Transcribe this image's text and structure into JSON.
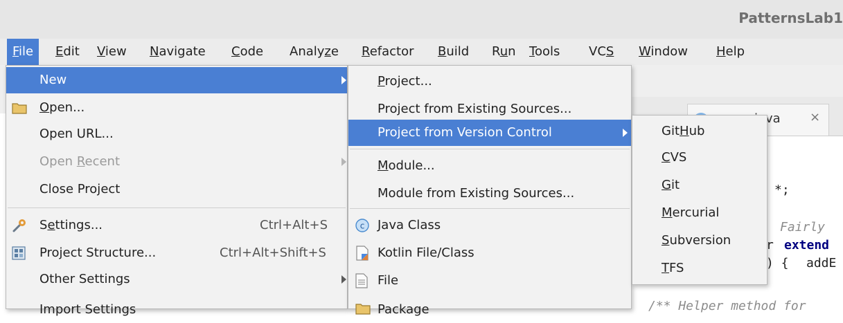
{
  "window": {
    "title": "PatternsLab1"
  },
  "menubar": [
    {
      "label": "File",
      "key": "F",
      "rest": "ile"
    },
    {
      "label": "Edit",
      "key": "E",
      "rest": "dit"
    },
    {
      "label": "View",
      "key": "V",
      "rest": "iew"
    },
    {
      "label": "Navigate",
      "key": "N",
      "rest": "avigate"
    },
    {
      "label": "Code",
      "key": "C",
      "rest": "ode"
    },
    {
      "label": "Analyze",
      "pre": "Analy",
      "key": "z",
      "rest": "e"
    },
    {
      "label": "Refactor",
      "key": "R",
      "rest": "efactor"
    },
    {
      "label": "Build",
      "key": "B",
      "rest": "uild"
    },
    {
      "label": "Run",
      "pre": "R",
      "key": "u",
      "rest": "n"
    },
    {
      "label": "Tools",
      "key": "T",
      "rest": "ools"
    },
    {
      "label": "VCS",
      "pre": "VC",
      "key": "S",
      "rest": ""
    },
    {
      "label": "Window",
      "key": "W",
      "rest": "indow"
    },
    {
      "label": "Help",
      "key": "H",
      "rest": "elp"
    }
  ],
  "file_menu": {
    "new": "New",
    "open": {
      "key": "O",
      "rest": "pen..."
    },
    "open_url": "Open URL...",
    "open_recent": {
      "pre": "Open ",
      "key": "R",
      "rest": "ecent"
    },
    "close_project": "Close Project",
    "settings": {
      "pre": "S",
      "key": "e",
      "rest": "ttings...",
      "shortcut": "Ctrl+Alt+S"
    },
    "project_structure": {
      "label": "Project Structure...",
      "shortcut": "Ctrl+Alt+Shift+S"
    },
    "other_settings": "Other Settings",
    "import_settings": "Import Settings"
  },
  "new_menu": {
    "project": {
      "key": "P",
      "rest": "roject..."
    },
    "project_from_sources": "Project from Existing Sources...",
    "project_from_vcs": "Project from Version Control",
    "module": {
      "key": "M",
      "rest": "odule..."
    },
    "module_from_sources": "Module from Existing Sources...",
    "java_class": "Java Class",
    "kotlin_file": "Kotlin File/Class",
    "file": "File",
    "package": "Package"
  },
  "vcs_menu": {
    "github": {
      "pre": "Git",
      "key": "H",
      "rest": "ub"
    },
    "cvs": {
      "key": "C",
      "rest": "VS"
    },
    "git": {
      "key": "G",
      "rest": "it"
    },
    "mercurial": {
      "key": "M",
      "rest": "ercurial"
    },
    "subversion": {
      "key": "S",
      "rest": "ubversion"
    },
    "tfs": {
      "key": "T",
      "rest": "FS"
    }
  },
  "editor": {
    "tab_label": "java",
    "tab_close": "×",
    "code_star": "*;",
    "code_comment": "Fairly",
    "code_r": "r",
    "code_extend": "extend",
    "code_brace": ") {",
    "code_adde": "addE",
    "code_helper": "/** Helper method for"
  },
  "colors": {
    "selection": "#4a7fd3",
    "menu_bg": "#f2f2f2",
    "menubar_bg": "#ececec",
    "titlebar_bg": "#e6e6e6",
    "disabled": "#9a9a9a"
  },
  "icons": [
    "folder-icon",
    "settings-wrench-icon",
    "project-structure-icon",
    "java-class-icon",
    "kotlin-file-icon",
    "file-icon",
    "package-icon",
    "submenu-arrow-icon"
  ]
}
